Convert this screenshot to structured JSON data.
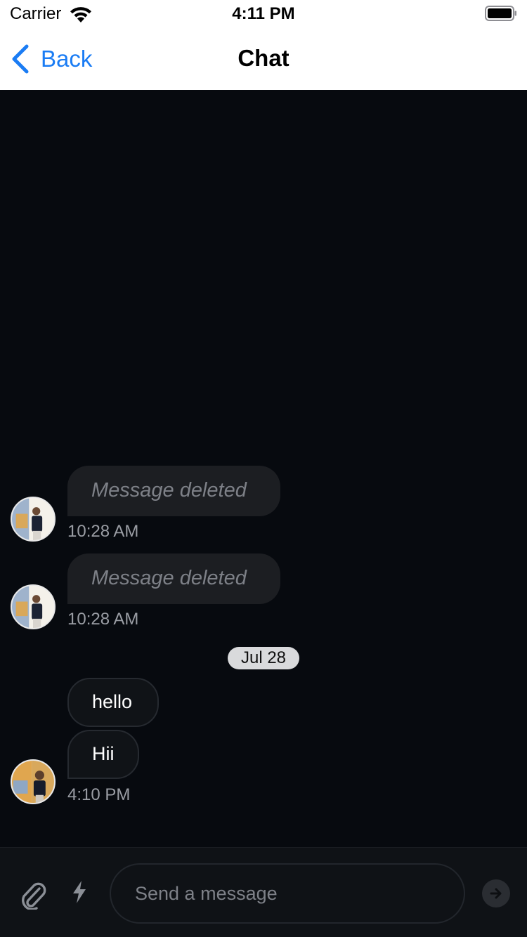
{
  "status_bar": {
    "carrier": "Carrier",
    "time": "4:11 PM",
    "wifi_icon": "wifi-icon",
    "battery_icon": "battery-full-icon"
  },
  "nav": {
    "back_label": "Back",
    "title": "Chat",
    "back_icon": "chevron-left-icon"
  },
  "messages": [
    {
      "type": "deleted",
      "text": "Message deleted",
      "time": "10:28 AM"
    },
    {
      "type": "deleted",
      "text": "Message deleted",
      "time": "10:28 AM"
    },
    {
      "type": "text",
      "text": "hello"
    },
    {
      "type": "text",
      "text": "Hii",
      "time": "4:10 PM"
    }
  ],
  "date_separator": "Jul 28",
  "composer": {
    "placeholder": "Send a message",
    "attach_icon": "paperclip-icon",
    "command_icon": "lightning-icon",
    "send_icon": "arrow-right-icon"
  },
  "colors": {
    "accent": "#1a7cf4",
    "chat_background": "#070a0f",
    "bubble": "#1c1e22"
  }
}
